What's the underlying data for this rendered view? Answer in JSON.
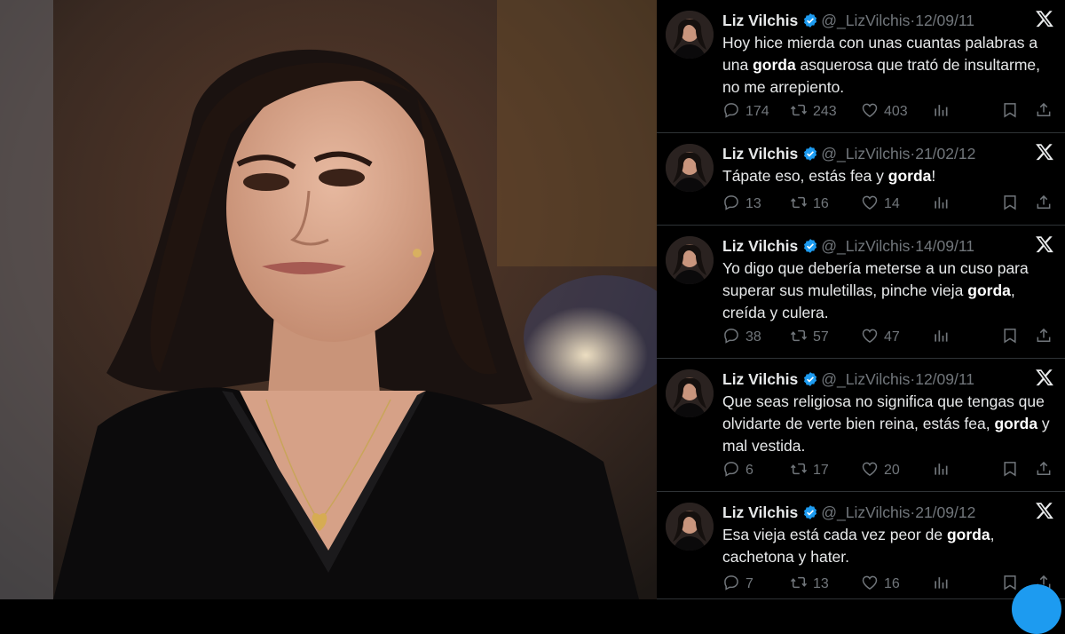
{
  "colors": {
    "background": "#000000",
    "text": "#e7e9ea",
    "secondary": "#71767b",
    "verified": "#1d9bf0",
    "divider": "#2f3336"
  },
  "photo": {
    "icon": "portrait-photo"
  },
  "tweets": [
    {
      "name": "Liz Vilchis",
      "handle": "@_LizVilchis",
      "separator": "·",
      "date": "12/09/11",
      "text": [
        {
          "t": "Hoy hice mierda con unas cuantas palabras a una "
        },
        {
          "t": "gorda",
          "bold": true
        },
        {
          "t": " asquerosa que trató de insultarme, no me arrepiento."
        }
      ],
      "replies": "174",
      "retweets": "243",
      "likes": "403"
    },
    {
      "name": "Liz Vilchis",
      "handle": "@_LizVilchis",
      "separator": "·",
      "date": "21/02/12",
      "text": [
        {
          "t": "Tápate eso, estás fea y "
        },
        {
          "t": "gorda",
          "bold": true
        },
        {
          "t": "!"
        }
      ],
      "replies": "13",
      "retweets": "16",
      "likes": "14"
    },
    {
      "name": "Liz Vilchis",
      "handle": "@_LizVilchis",
      "separator": "·",
      "date": "14/09/11",
      "text": [
        {
          "t": "Yo digo que debería meterse a un cuso para superar sus muletillas, pinche vieja "
        },
        {
          "t": "gorda",
          "bold": true
        },
        {
          "t": ", creída y culera."
        }
      ],
      "replies": "38",
      "retweets": "57",
      "likes": "47"
    },
    {
      "name": "Liz Vilchis",
      "handle": "@_LizVilchis",
      "separator": "·",
      "date": "12/09/11",
      "text": [
        {
          "t": "Que seas religiosa no significa que tengas que olvidarte de verte bien reina, estás fea, "
        },
        {
          "t": "gorda",
          "bold": true
        },
        {
          "t": " y mal vestida."
        }
      ],
      "replies": "6",
      "retweets": "17",
      "likes": "20"
    },
    {
      "name": "Liz Vilchis",
      "handle": "@_LizVilchis",
      "separator": "·",
      "date": "21/09/12",
      "text": [
        {
          "t": "Esa vieja está cada vez peor de "
        },
        {
          "t": "gorda",
          "bold": true
        },
        {
          "t": ", cachetona y hater."
        }
      ],
      "replies": "7",
      "retweets": "13",
      "likes": "16"
    }
  ]
}
